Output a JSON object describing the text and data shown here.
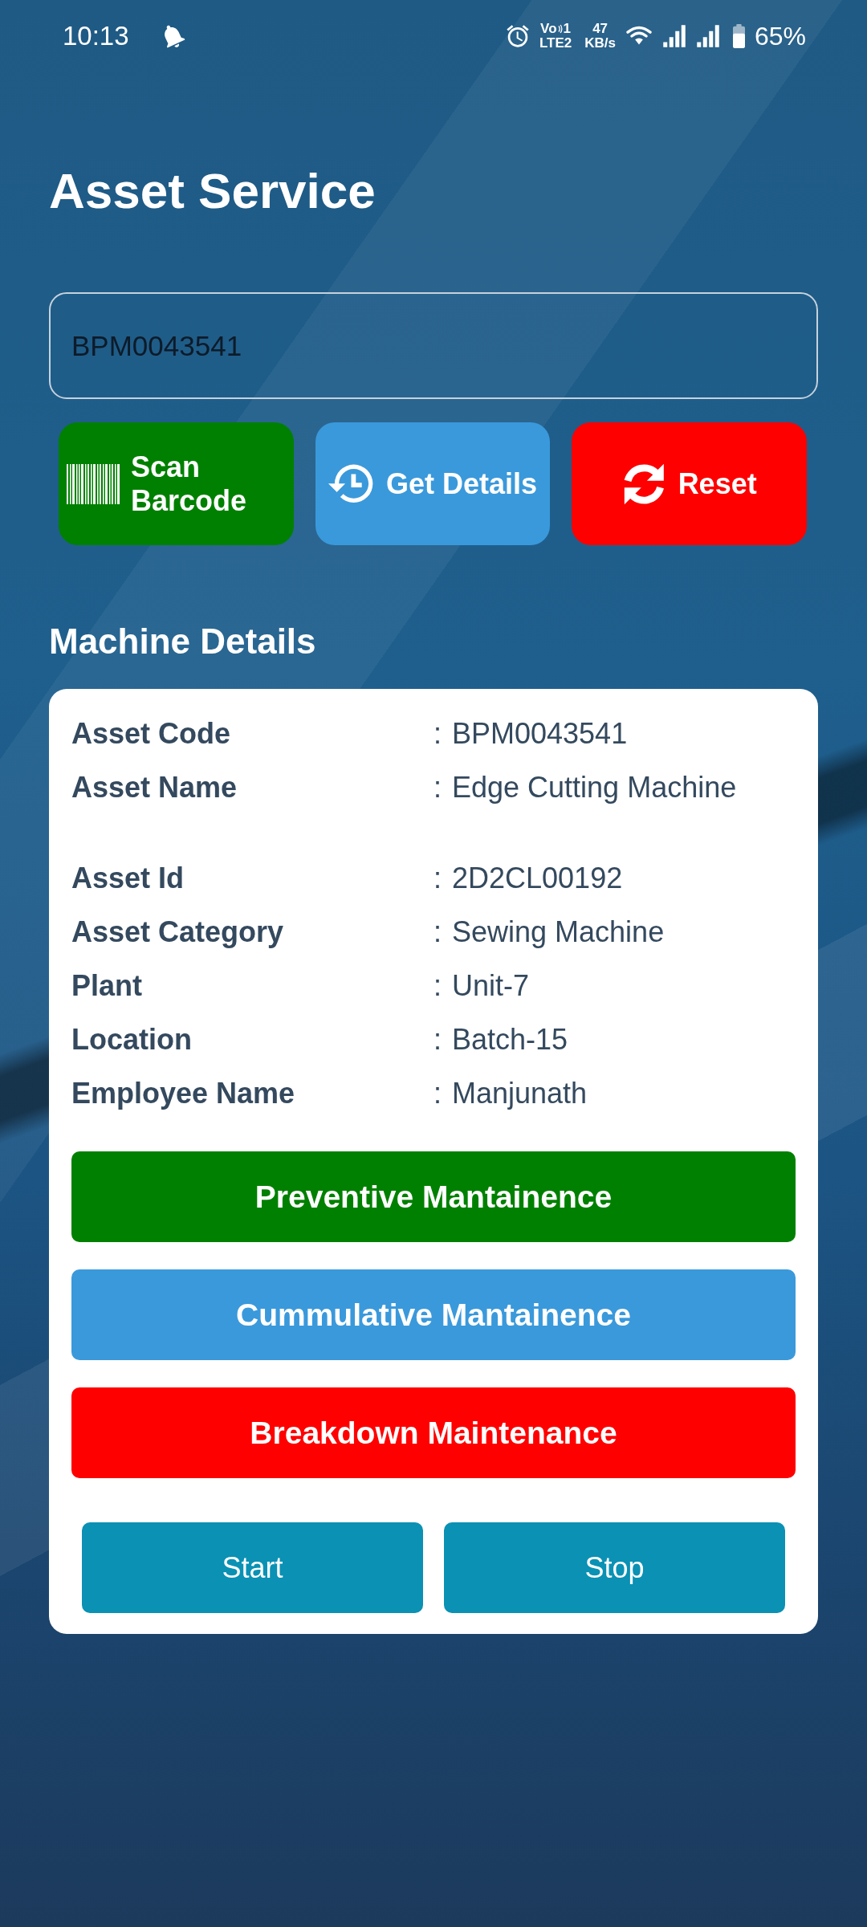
{
  "status_bar": {
    "time": "10:13",
    "volte": {
      "voice": "Vo",
      "sim": "1",
      "network": "LTE2"
    },
    "speed": {
      "value": "47",
      "unit": "KB/s"
    },
    "battery": "65%"
  },
  "title": "Asset Service",
  "asset_field": {
    "value": "BPM0043541"
  },
  "actions": [
    {
      "kind": "scan",
      "label": "Scan Barcode",
      "color": "#008000"
    },
    {
      "kind": "details",
      "label": "Get Details",
      "color": "#3a99db"
    },
    {
      "kind": "reset",
      "label": "Reset",
      "color": "#ff0000"
    }
  ],
  "section_title": "Machine Details",
  "detail_groups": [
    {
      "rows": [
        {
          "label": "Asset Code",
          "separator": ":",
          "value": "BPM0043541"
        },
        {
          "label": "Asset Name",
          "separator": ":",
          "value": "Edge Cutting Machine"
        }
      ]
    },
    {
      "rows": [
        {
          "label": "Asset Id",
          "separator": ":",
          "value": "2D2CL00192"
        },
        {
          "label": "Asset Category",
          "separator": ":",
          "value": "Sewing Machine"
        },
        {
          "label": "Plant",
          "separator": ":",
          "value": "Unit-7"
        },
        {
          "label": "Location",
          "separator": ":",
          "value": "Batch-15"
        },
        {
          "label": "Employee Name",
          "separator": ":",
          "value": "Manjunath"
        }
      ]
    }
  ],
  "maintenance_buttons": [
    {
      "label": "Preventive Mantainence",
      "color": "#008000"
    },
    {
      "label": "Cummulative Mantainence",
      "color": "#3a99db"
    },
    {
      "label": "Breakdown Maintenance",
      "color": "#ff0000"
    }
  ],
  "timer_buttons": [
    {
      "label": "Start"
    },
    {
      "label": "Stop"
    }
  ]
}
